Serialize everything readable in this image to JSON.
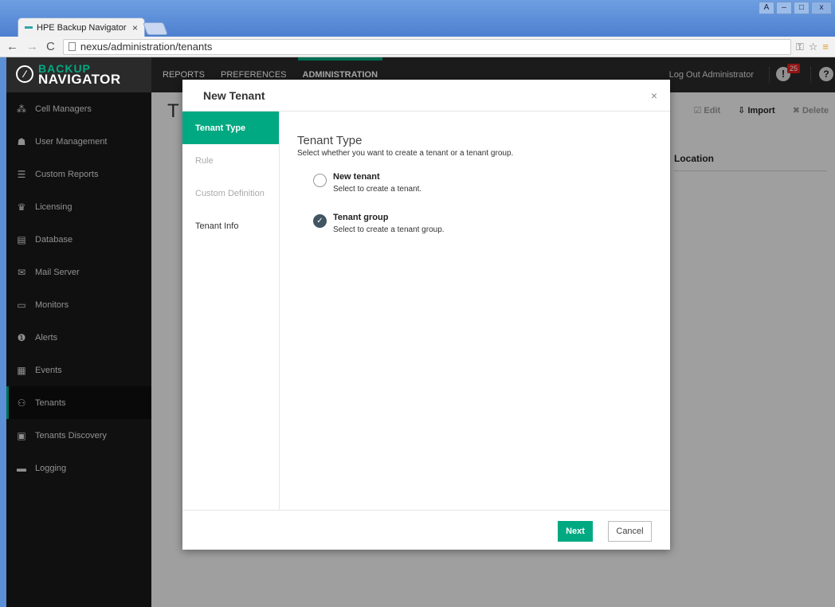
{
  "browser": {
    "tab_title": "HPE Backup Navigator",
    "tab_close": "×",
    "url": "nexus/administration/tenants"
  },
  "app": {
    "logo_top": "BACKUP",
    "logo_bottom": "NAVIGATOR",
    "nav": [
      "REPORTS",
      "PREFERENCES",
      "ADMINISTRATION"
    ],
    "logout": "Log Out Administrator",
    "alert_count": "25",
    "sidebar": [
      {
        "label": "Cell Managers",
        "icon": "⁂"
      },
      {
        "label": "User Management",
        "icon": "☗"
      },
      {
        "label": "Custom Reports",
        "icon": "☰"
      },
      {
        "label": "Licensing",
        "icon": "♛"
      },
      {
        "label": "Database",
        "icon": "▤"
      },
      {
        "label": "Mail Server",
        "icon": "✉"
      },
      {
        "label": "Monitors",
        "icon": "▭"
      },
      {
        "label": "Alerts",
        "icon": "❶"
      },
      {
        "label": "Events",
        "icon": "▦"
      },
      {
        "label": "Tenants",
        "icon": "⚇"
      },
      {
        "label": "Tenants Discovery",
        "icon": "▣"
      },
      {
        "label": "Logging",
        "icon": "▬"
      }
    ],
    "content_title": "T",
    "actions": {
      "edit": "Edit",
      "import": "Import",
      "delete": "Delete"
    },
    "column_location": "Location"
  },
  "modal": {
    "title": "New Tenant",
    "close": "×",
    "steps": [
      "Tenant Type",
      "Rule",
      "Custom Definition",
      "Tenant Info"
    ],
    "pane_title": "Tenant Type",
    "pane_subtitle": "Select whether you want to create a tenant or a tenant group.",
    "options": [
      {
        "label": "New tenant",
        "desc": "Select to create a tenant.",
        "checked": false
      },
      {
        "label": "Tenant group",
        "desc": "Select to create a tenant group.",
        "checked": true
      }
    ],
    "next": "Next",
    "cancel": "Cancel"
  }
}
